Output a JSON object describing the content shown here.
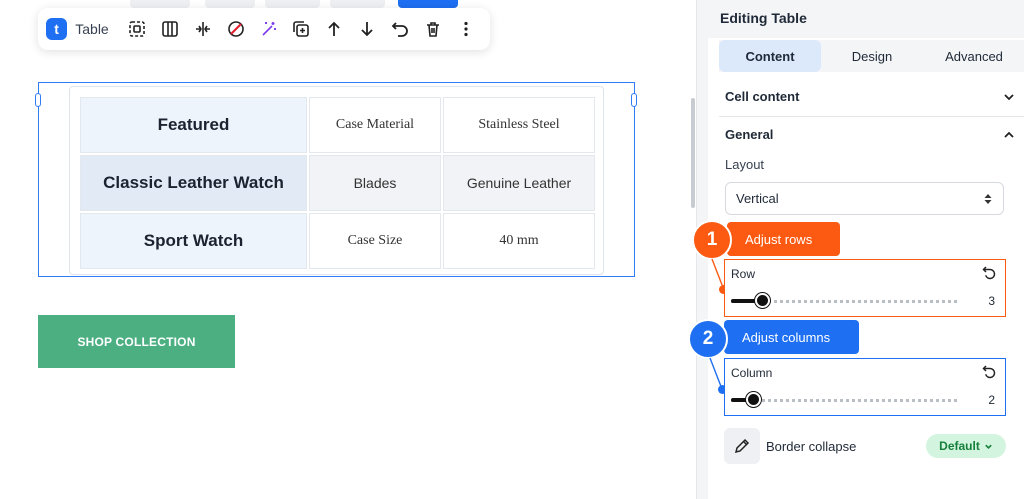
{
  "toolbar": {
    "logo": "t",
    "label": "Table"
  },
  "table": {
    "rows": [
      [
        "Featured",
        "Case Material",
        "Stainless Steel"
      ],
      [
        "Classic Leather Watch",
        "Blades",
        "Genuine Leather"
      ],
      [
        "Sport Watch",
        "Case Size",
        "40 mm"
      ]
    ]
  },
  "shop_button": "SHOP COLLECTION",
  "panel": {
    "title": "Editing Table",
    "tabs": [
      {
        "label": "Content",
        "active": true
      },
      {
        "label": "Design",
        "active": false
      },
      {
        "label": "Advanced",
        "active": false
      }
    ],
    "cell_content_label": "Cell content",
    "general_label": "General",
    "layout_label": "Layout",
    "layout_value": "Vertical",
    "border_collapse_label": "Border collapse",
    "border_collapse_value": "Default"
  },
  "callouts": {
    "rows": {
      "number": "1",
      "text": "Adjust rows",
      "color": "#fc5a12"
    },
    "columns": {
      "number": "2",
      "text": "Adjust columns",
      "color": "#1e6ff2"
    }
  },
  "row_control": {
    "label": "Row",
    "value": "3",
    "fraction": 0.14
  },
  "column_control": {
    "label": "Column",
    "value": "2",
    "fraction": 0.1
  },
  "colors": {
    "accent": "#1e6ff2",
    "highlight_orange": "#fc5a12",
    "shop_button": "#4caf82",
    "default_pill": "#d3f5df"
  }
}
